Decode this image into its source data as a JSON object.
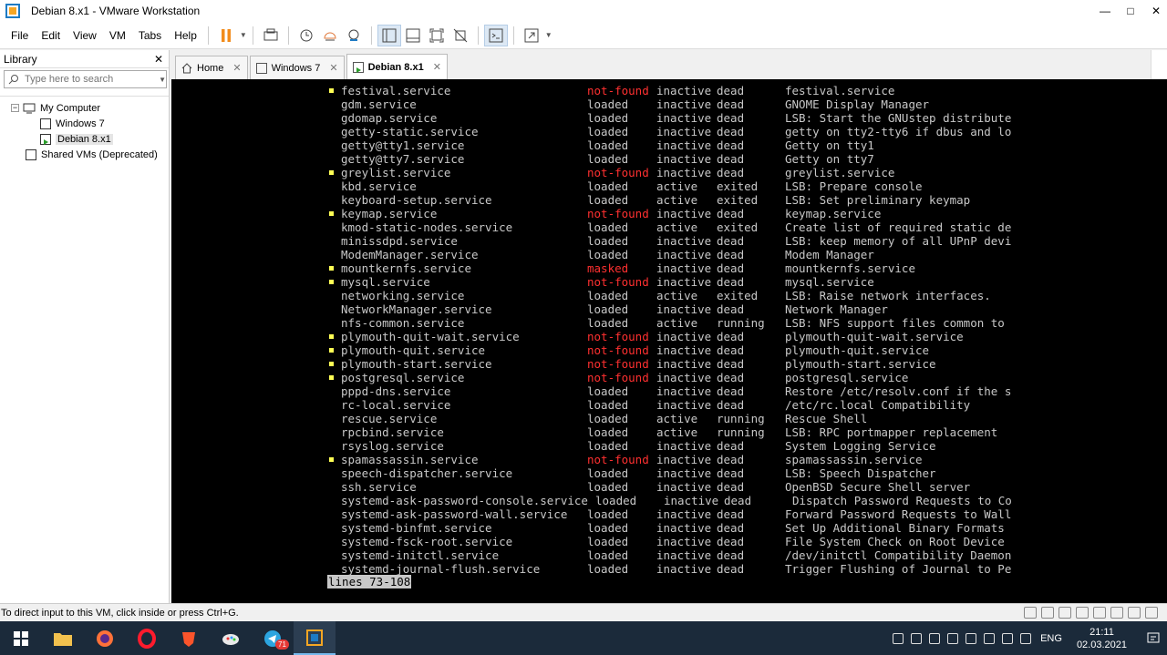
{
  "window": {
    "title": "Debian 8.x1 - VMware Workstation",
    "minimize": "—",
    "maximize": "□",
    "close": "✕"
  },
  "menu": [
    "File",
    "Edit",
    "View",
    "VM",
    "Tabs",
    "Help"
  ],
  "library": {
    "title": "Library",
    "close": "✕",
    "search_placeholder": "Type here to search",
    "items": [
      {
        "label": "My Computer",
        "expander": "−"
      },
      {
        "label": "Windows 7"
      },
      {
        "label": "Debian 8.x1"
      },
      {
        "label": "Shared VMs (Deprecated)"
      }
    ]
  },
  "tabs": [
    {
      "label": "Home",
      "close": "✕"
    },
    {
      "label": "Windows 7",
      "close": "✕"
    },
    {
      "label": "Debian 8.x1",
      "close": "✕"
    }
  ],
  "console": {
    "rows": [
      {
        "bullet": true,
        "unit": "festival.service",
        "load": "not-found",
        "active": "inactive",
        "sub": "dead",
        "desc": "festival.service"
      },
      {
        "bullet": false,
        "unit": "gdm.service",
        "load": "loaded",
        "active": "inactive",
        "sub": "dead",
        "desc": "GNOME Display Manager"
      },
      {
        "bullet": false,
        "unit": "gdomap.service",
        "load": "loaded",
        "active": "inactive",
        "sub": "dead",
        "desc": "LSB: Start the GNUstep distribute"
      },
      {
        "bullet": false,
        "unit": "getty-static.service",
        "load": "loaded",
        "active": "inactive",
        "sub": "dead",
        "desc": "getty on tty2-tty6 if dbus and lo"
      },
      {
        "bullet": false,
        "unit": "getty@tty1.service",
        "load": "loaded",
        "active": "inactive",
        "sub": "dead",
        "desc": "Getty on tty1"
      },
      {
        "bullet": false,
        "unit": "getty@tty7.service",
        "load": "loaded",
        "active": "inactive",
        "sub": "dead",
        "desc": "Getty on tty7"
      },
      {
        "bullet": true,
        "unit": "greylist.service",
        "load": "not-found",
        "active": "inactive",
        "sub": "dead",
        "desc": "greylist.service"
      },
      {
        "bullet": false,
        "unit": "kbd.service",
        "load": "loaded",
        "active": "active",
        "sub": "exited",
        "desc": "LSB: Prepare console"
      },
      {
        "bullet": false,
        "unit": "keyboard-setup.service",
        "load": "loaded",
        "active": "active",
        "sub": "exited",
        "desc": "LSB: Set preliminary keymap"
      },
      {
        "bullet": true,
        "unit": "keymap.service",
        "load": "not-found",
        "active": "inactive",
        "sub": "dead",
        "desc": "keymap.service"
      },
      {
        "bullet": false,
        "unit": "kmod-static-nodes.service",
        "load": "loaded",
        "active": "active",
        "sub": "exited",
        "desc": "Create list of required static de"
      },
      {
        "bullet": false,
        "unit": "minissdpd.service",
        "load": "loaded",
        "active": "inactive",
        "sub": "dead",
        "desc": "LSB: keep memory of all UPnP devi"
      },
      {
        "bullet": false,
        "unit": "ModemManager.service",
        "load": "loaded",
        "active": "inactive",
        "sub": "dead",
        "desc": "Modem Manager"
      },
      {
        "bullet": true,
        "unit": "mountkernfs.service",
        "load": "masked",
        "active": "inactive",
        "sub": "dead",
        "desc": "mountkernfs.service"
      },
      {
        "bullet": true,
        "unit": "mysql.service",
        "load": "not-found",
        "active": "inactive",
        "sub": "dead",
        "desc": "mysql.service"
      },
      {
        "bullet": false,
        "unit": "networking.service",
        "load": "loaded",
        "active": "active",
        "sub": "exited",
        "desc": "LSB: Raise network interfaces."
      },
      {
        "bullet": false,
        "unit": "NetworkManager.service",
        "load": "loaded",
        "active": "inactive",
        "sub": "dead",
        "desc": "Network Manager"
      },
      {
        "bullet": false,
        "unit": "nfs-common.service",
        "load": "loaded",
        "active": "active",
        "sub": "running",
        "desc": "LSB: NFS support files common to"
      },
      {
        "bullet": true,
        "unit": "plymouth-quit-wait.service",
        "load": "not-found",
        "active": "inactive",
        "sub": "dead",
        "desc": "plymouth-quit-wait.service"
      },
      {
        "bullet": true,
        "unit": "plymouth-quit.service",
        "load": "not-found",
        "active": "inactive",
        "sub": "dead",
        "desc": "plymouth-quit.service"
      },
      {
        "bullet": true,
        "unit": "plymouth-start.service",
        "load": "not-found",
        "active": "inactive",
        "sub": "dead",
        "desc": "plymouth-start.service"
      },
      {
        "bullet": true,
        "unit": "postgresql.service",
        "load": "not-found",
        "active": "inactive",
        "sub": "dead",
        "desc": "postgresql.service"
      },
      {
        "bullet": false,
        "unit": "pppd-dns.service",
        "load": "loaded",
        "active": "inactive",
        "sub": "dead",
        "desc": "Restore /etc/resolv.conf if the s"
      },
      {
        "bullet": false,
        "unit": "rc-local.service",
        "load": "loaded",
        "active": "inactive",
        "sub": "dead",
        "desc": "/etc/rc.local Compatibility"
      },
      {
        "bullet": false,
        "unit": "rescue.service",
        "load": "loaded",
        "active": "active",
        "sub": "running",
        "desc": "Rescue Shell"
      },
      {
        "bullet": false,
        "unit": "rpcbind.service",
        "load": "loaded",
        "active": "active",
        "sub": "running",
        "desc": "LSB: RPC portmapper replacement"
      },
      {
        "bullet": false,
        "unit": "rsyslog.service",
        "load": "loaded",
        "active": "inactive",
        "sub": "dead",
        "desc": "System Logging Service"
      },
      {
        "bullet": true,
        "unit": "spamassassin.service",
        "load": "not-found",
        "active": "inactive",
        "sub": "dead",
        "desc": "spamassassin.service"
      },
      {
        "bullet": false,
        "unit": "speech-dispatcher.service",
        "load": "loaded",
        "active": "inactive",
        "sub": "dead",
        "desc": "LSB: Speech Dispatcher"
      },
      {
        "bullet": false,
        "unit": "ssh.service",
        "load": "loaded",
        "active": "inactive",
        "sub": "dead",
        "desc": "OpenBSD Secure Shell server"
      },
      {
        "bullet": false,
        "unit": "systemd-ask-password-console.service",
        "load": "loaded",
        "active": "inactive",
        "sub": "dead",
        "desc": "Dispatch Password Requests to Co",
        "shift": true
      },
      {
        "bullet": false,
        "unit": "systemd-ask-password-wall.service",
        "load": "loaded",
        "active": "inactive",
        "sub": "dead",
        "desc": "Forward Password Requests to Wall"
      },
      {
        "bullet": false,
        "unit": "systemd-binfmt.service",
        "load": "loaded",
        "active": "inactive",
        "sub": "dead",
        "desc": "Set Up Additional Binary Formats"
      },
      {
        "bullet": false,
        "unit": "systemd-fsck-root.service",
        "load": "loaded",
        "active": "inactive",
        "sub": "dead",
        "desc": "File System Check on Root Device"
      },
      {
        "bullet": false,
        "unit": "systemd-initctl.service",
        "load": "loaded",
        "active": "inactive",
        "sub": "dead",
        "desc": "/dev/initctl Compatibility Daemon"
      },
      {
        "bullet": false,
        "unit": "systemd-journal-flush.service",
        "load": "loaded",
        "active": "inactive",
        "sub": "dead",
        "desc": "Trigger Flushing of Journal to Pe"
      }
    ],
    "pager": "lines 73-108"
  },
  "status": {
    "hint": "To direct input to this VM, click inside or press Ctrl+G."
  },
  "taskbar": {
    "lang": "ENG",
    "time": "21:11",
    "date": "02.03.2021",
    "telegram_badge": "71"
  },
  "colors": {
    "accent": "#1e7bc4",
    "error_red": "#ff3030",
    "bullet_yellow": "#ffff55",
    "console_bg": "#000000",
    "taskbar_bg": "#1b2a3a"
  }
}
